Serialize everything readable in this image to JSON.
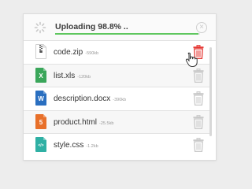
{
  "upload": {
    "status_text": "Uploading 98.8% ..",
    "progress": 0.988
  },
  "files": [
    {
      "name": "code.zip",
      "size": "-590kb",
      "type": "zip",
      "color": "#ffffff"
    },
    {
      "name": "list.xls",
      "size": "-120kb",
      "type": "xls",
      "color": "#3aa65a"
    },
    {
      "name": "description.docx",
      "size": "-390kb",
      "type": "docx",
      "color": "#2a6fc0"
    },
    {
      "name": "product.html",
      "size": "-25.5kb",
      "type": "html",
      "color": "#e8702a"
    },
    {
      "name": "style.css",
      "size": "-1.2kb",
      "type": "css",
      "color": "#2fb0a4"
    }
  ],
  "colors": {
    "progress": "#5fc75f",
    "delete_hover": "#e53935",
    "trash_default": "#c9c9c9"
  },
  "icons": {
    "spinner": "loading-spinner-icon",
    "cancel": "close-circle-icon",
    "delete": "trash-icon",
    "cursor": "hand-pointer-icon"
  }
}
